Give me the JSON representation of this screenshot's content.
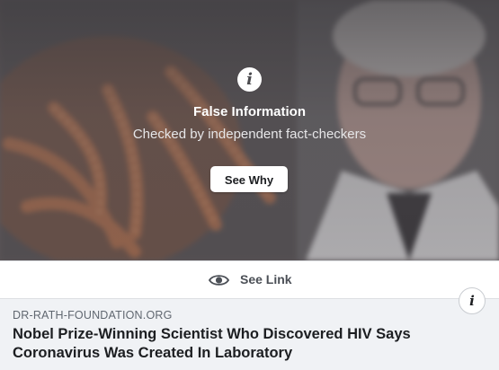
{
  "warning": {
    "icon": "info-icon",
    "title": "False Information",
    "subtitle": "Checked by independent fact-checkers",
    "button_label": "See Why"
  },
  "see_link": {
    "icon": "eye-icon",
    "label": "See Link"
  },
  "link_preview": {
    "domain": "DR-RATH-FOUNDATION.ORG",
    "headline": "Nobel Prize-Winning Scientist Who Discovered HIV Says Coronavirus Was Created In Laboratory",
    "info_icon": "info-icon"
  },
  "colors": {
    "overlay": "#3c3a3e",
    "bar_background": "#ffffff",
    "meta_background": "#f0f2f5",
    "headline": "#1c1e21",
    "domain": "#606770"
  }
}
